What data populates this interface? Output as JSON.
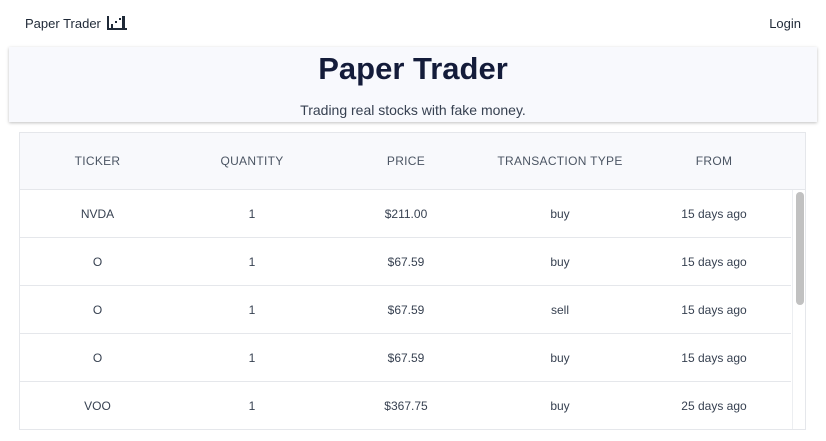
{
  "navbar": {
    "brand": "Paper Trader",
    "brand_icon": "chart-bars-icon",
    "login": "Login"
  },
  "hero": {
    "title": "Paper Trader",
    "subtitle": "Trading real stocks with fake money."
  },
  "table": {
    "columns": [
      "TICKER",
      "QUANTITY",
      "PRICE",
      "TRANSACTION TYPE",
      "FROM"
    ],
    "rows": [
      [
        "NVDA",
        "1",
        "$211.00",
        "buy",
        "15 days ago"
      ],
      [
        "O",
        "1",
        "$67.59",
        "buy",
        "15 days ago"
      ],
      [
        "O",
        "1",
        "$67.59",
        "sell",
        "15 days ago"
      ],
      [
        "O",
        "1",
        "$67.59",
        "buy",
        "15 days ago"
      ],
      [
        "VOO",
        "1",
        "$367.75",
        "buy",
        "25 days ago"
      ]
    ]
  },
  "colors": {
    "title": "#141c3a",
    "hero_bg": "#f8f9fd",
    "header_bg": "#f8f9fc",
    "border": "#e5e7eb",
    "scroll_thumb": "#c1c1c1"
  }
}
